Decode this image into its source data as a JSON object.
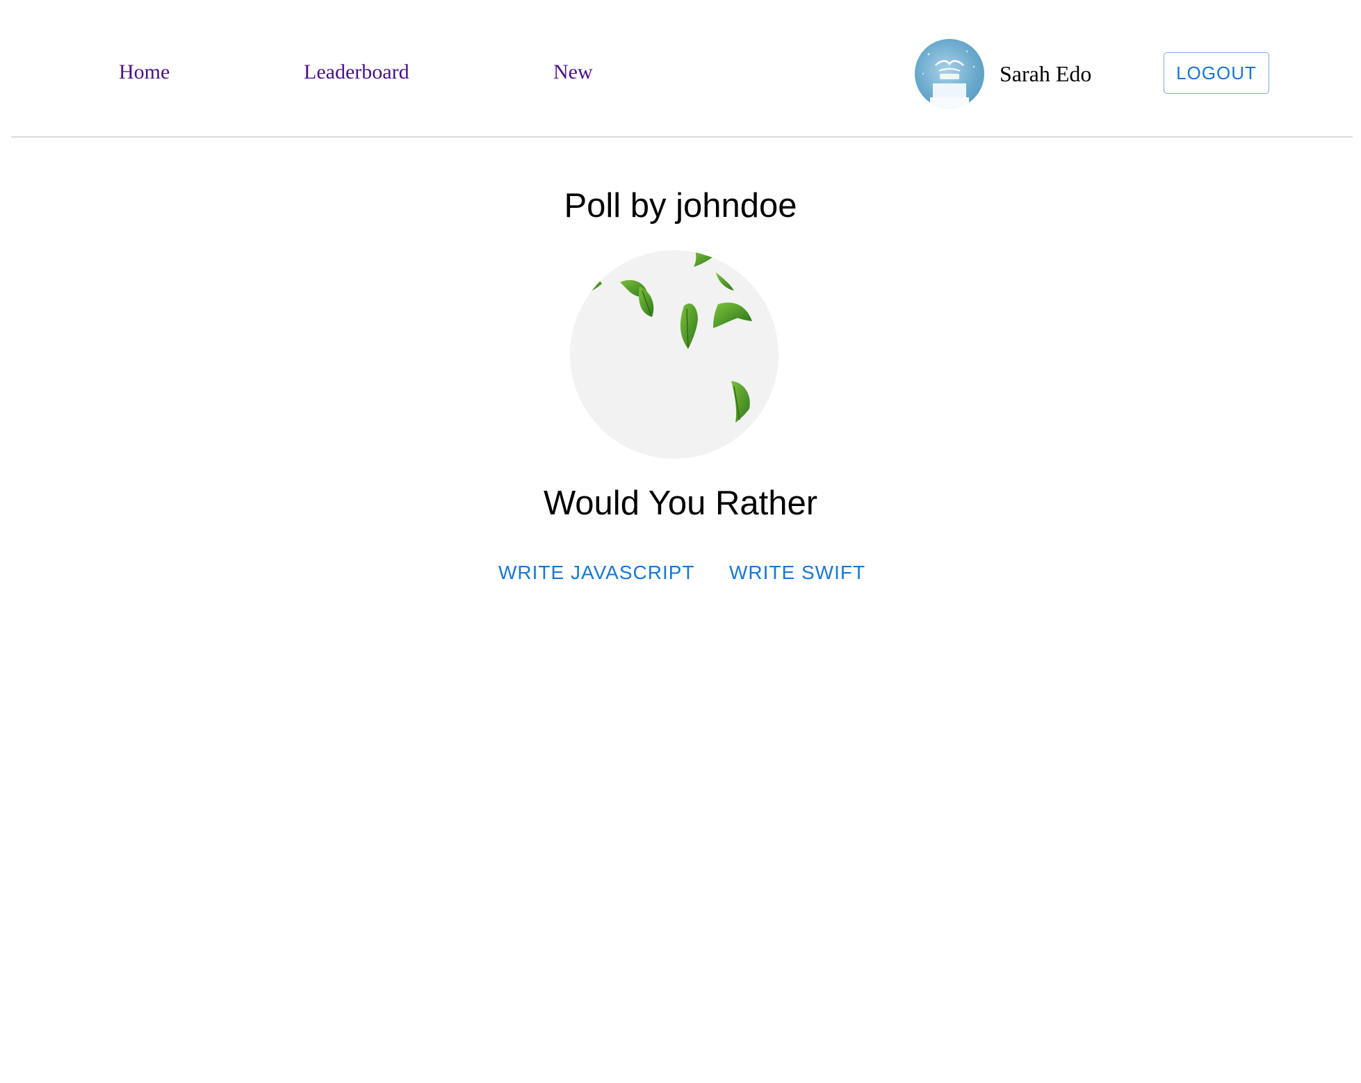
{
  "nav": {
    "links": [
      {
        "label": "Home"
      },
      {
        "label": "Leaderboard"
      },
      {
        "label": "New"
      }
    ]
  },
  "user": {
    "name": "Sarah Edo",
    "avatar_icon": "winter-sale-image"
  },
  "logout": {
    "label": "LOGOUT"
  },
  "poll": {
    "title": "Poll by johndoe",
    "author_avatar_icon": "green-leaves-image",
    "question": "Would You Rather",
    "options": [
      {
        "label": "WRITE JAVASCRIPT"
      },
      {
        "label": "WRITE SWIFT"
      }
    ]
  },
  "colors": {
    "nav_link": "#4b0f8a",
    "accent": "#1976d2",
    "divider": "#dcdcdc"
  }
}
